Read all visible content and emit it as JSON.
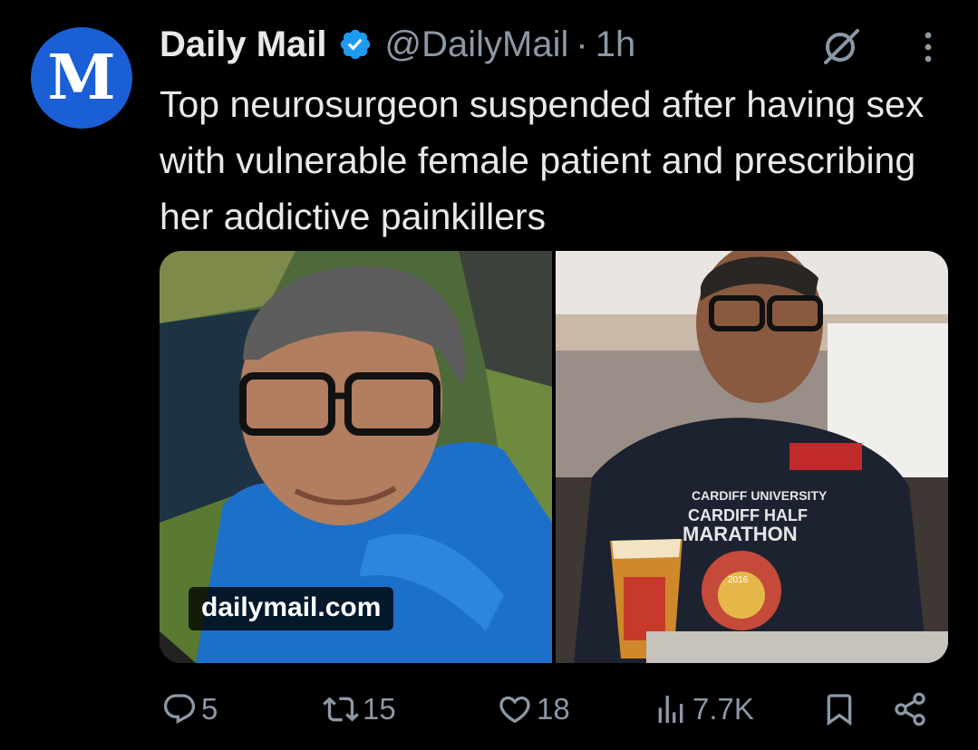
{
  "tweet": {
    "avatar_glyph": "M",
    "author_name": "Daily Mail",
    "handle": "@DailyMail",
    "separator": "·",
    "timestamp": "1h",
    "text": "Top neurosurgeon suspended after having sex with vulnerable female patient and prescribing her addictive painkillers",
    "media": {
      "source_label": "dailymail.com",
      "shirt_text_line1": "CARDIFF UNIVERSITY",
      "shirt_text_line2": "CARDIFF HALF",
      "shirt_text_line3": "MARATHON",
      "badge_year": "2016"
    },
    "stats": {
      "replies": "5",
      "reposts": "15",
      "likes": "18",
      "views": "7.7K"
    }
  },
  "colors": {
    "background": "#000000",
    "text_primary": "#e7e9ea",
    "text_secondary": "#8b98a5",
    "verified_blue": "#1d9bf0",
    "avatar_blue": "#1a5fd6"
  },
  "icons": [
    "verified-badge-icon",
    "grok-icon",
    "more-icon",
    "reply-icon",
    "repost-icon",
    "like-icon",
    "views-icon",
    "bookmark-icon",
    "share-icon"
  ]
}
